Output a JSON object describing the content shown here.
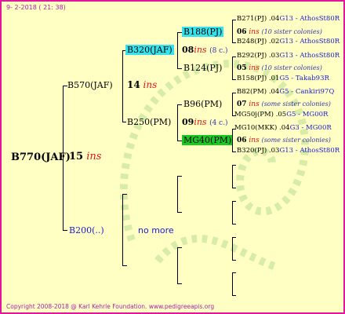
{
  "date": "9- 2-2018 ( 21: 38)",
  "copyright": "Copyright 2008-2018 @ Karl Kehrle Foundation.   www.pedigreeapis.org",
  "root": {
    "label": "B770(JAF)",
    "num": "15",
    "ins": "ins"
  },
  "gen1": {
    "top": {
      "label": "B570(JAF)",
      "num": "14",
      "ins": "ins"
    },
    "bottom": {
      "label": "B200(..)",
      "nomore": "no more"
    }
  },
  "gen2": {
    "a": {
      "label": "B320(JAF)",
      "num": "08",
      "ins": "ins",
      "sub": "(8 c.)"
    },
    "b": {
      "label": "B250(PM)",
      "num": "09",
      "ins": "ins",
      "sub": "(4 c.)"
    }
  },
  "gen3": {
    "a": {
      "label": "B188(PJ)",
      "num": "06",
      "ins": "ins",
      "sub": "(10 sister colonies)"
    },
    "b": {
      "label": "B124(PJ)",
      "num": "05",
      "ins": "ins",
      "sub": "(10 sister colonies)"
    },
    "c": {
      "label": "B96(PM)",
      "num": "07",
      "ins": "ins",
      "sub": "(some sister colonies)"
    },
    "d": {
      "label": "MG40(PM)",
      "num": "06",
      "ins": "ins",
      "sub": "(some sister colonies)"
    }
  },
  "leaves": {
    "a1": {
      "p": "B271(PJ) .04",
      "v": "G13 - AthosSt80R"
    },
    "a2": {
      "p": "B248(PJ) .02",
      "v": "G13 - AthosSt80R"
    },
    "b1": {
      "p": "B292(PJ) .03",
      "v": "G13 - AthosSt80R"
    },
    "b2": {
      "p": "B158(PJ) .01",
      "v": "G5 - Takab93R"
    },
    "c1": {
      "p": "B82(PM) .04",
      "v": "G5 - Cankiri97Q"
    },
    "c2": {
      "p": "MG50j(PM) .05",
      "v": "G5 - MG00R"
    },
    "d1": {
      "p": "MG10(MKK) .04",
      "v": "G3 - MG00R"
    },
    "d2": {
      "p": "B320(PJ) .03",
      "v": "G13 - AthosSt80R"
    }
  },
  "colors": {
    "frame": "#e0179b",
    "background": "#ffffc4",
    "highlight_cyan": "#33e4ef",
    "highlight_green": "#18c91f",
    "ins": "#e8121b"
  }
}
